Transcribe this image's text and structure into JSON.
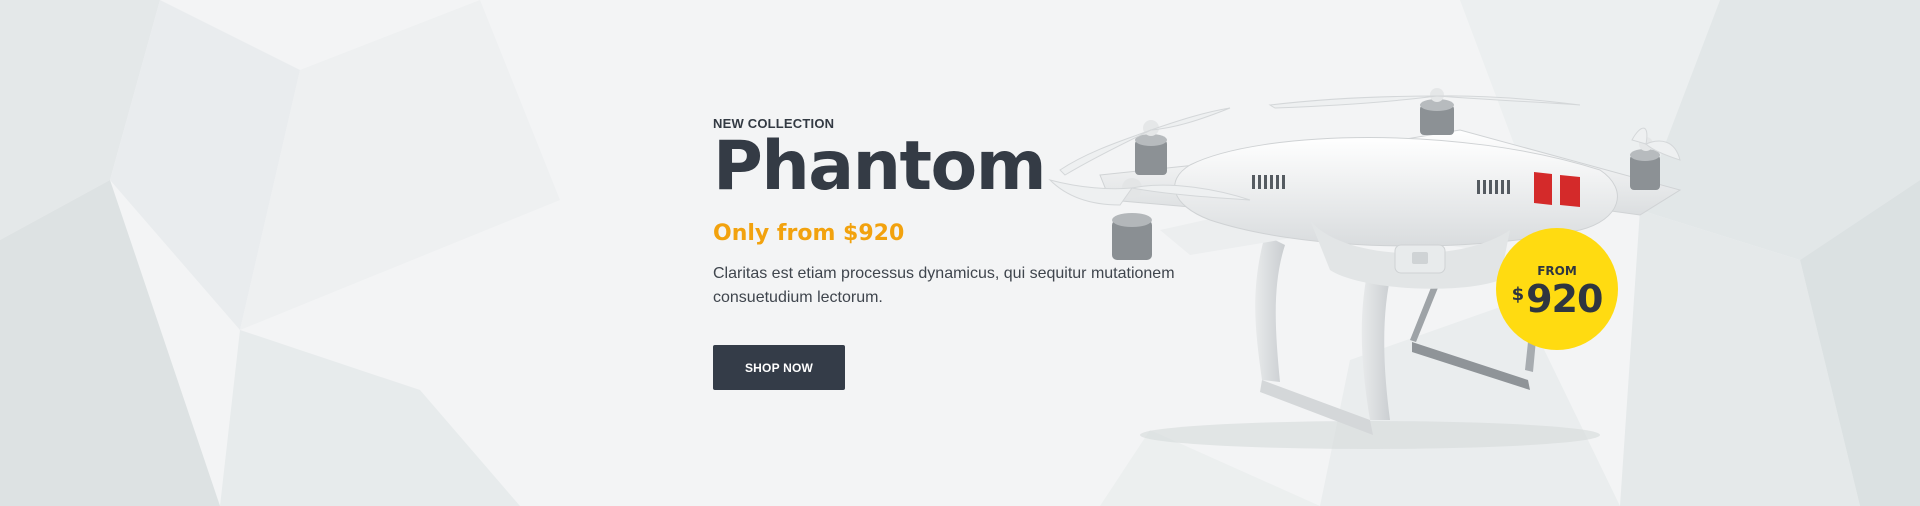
{
  "slide": {
    "eyebrow": "NEW COLLECTION",
    "title": "Phantom",
    "subtitle": "Only from $920",
    "description": "Claritas est etiam processus dynamicus, qui sequitur mutationem consuetudium lectorum.",
    "cta_label": "SHOP NOW"
  },
  "badge": {
    "label": "FROM",
    "currency": "$",
    "value": "920"
  },
  "colors": {
    "accent": "#f2a20e",
    "button_bg": "#343c48",
    "badge_bg": "#ffdb11",
    "heading": "#343b45"
  },
  "image": {
    "icon": "quadcopter-drone-image"
  }
}
